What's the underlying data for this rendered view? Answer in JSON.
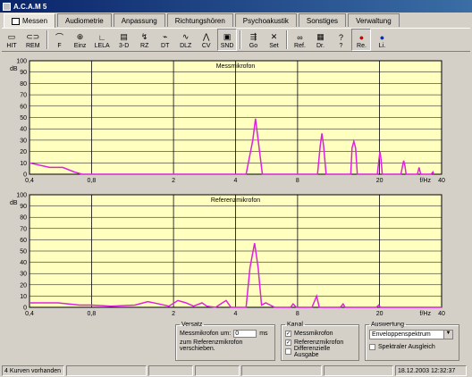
{
  "window": {
    "title": "A.C.A.M 5"
  },
  "tabs": [
    {
      "label": "Messen",
      "active": true
    },
    {
      "label": "Audiometrie"
    },
    {
      "label": "Anpassung"
    },
    {
      "label": "Richtungshören"
    },
    {
      "label": "Psychoakustik"
    },
    {
      "label": "Sonstiges"
    },
    {
      "label": "Verwaltung"
    }
  ],
  "toolbar": [
    {
      "label": "HIT",
      "icon": "hit-icon"
    },
    {
      "label": "REM",
      "icon": "rem-icon"
    },
    {
      "label": "F",
      "icon": "frequency-icon",
      "dropdown": true
    },
    {
      "label": "Einz",
      "icon": "single-icon",
      "dropdown": true
    },
    {
      "label": "LELA",
      "icon": "lela-icon"
    },
    {
      "label": "3-D",
      "icon": "3d-icon",
      "dropdown": true
    },
    {
      "label": "RZ",
      "icon": "rz-icon",
      "dropdown": true
    },
    {
      "label": "DT",
      "icon": "dt-icon",
      "dropdown": true
    },
    {
      "label": "DLZ",
      "icon": "dlz-icon"
    },
    {
      "label": "CV",
      "icon": "cv-icon"
    },
    {
      "label": "SND",
      "icon": "snd-icon",
      "dropdown": true
    },
    {
      "label": "Go",
      "icon": "go-icon",
      "dropdown": true
    },
    {
      "label": "Set",
      "icon": "settings-icon",
      "dropdown": true
    },
    {
      "label": "Ref.",
      "icon": "glasses-icon"
    },
    {
      "label": "Dr.",
      "icon": "printer-icon"
    },
    {
      "label": "?",
      "icon": "help-icon"
    },
    {
      "label": "Re.",
      "icon": "right-ear-icon"
    },
    {
      "label": "Li.",
      "icon": "left-ear-icon"
    }
  ],
  "chart_data": [
    {
      "type": "line",
      "title": "Messmikrofon",
      "ylabel": "dB",
      "xlabel": "f/Hz",
      "xscale": "log",
      "xlim": [
        0.4,
        40
      ],
      "ylim": [
        0,
        100
      ],
      "yticks": [
        0,
        10,
        20,
        30,
        40,
        50,
        60,
        70,
        80,
        90,
        100
      ],
      "xticks": [
        "0,4",
        "0,8",
        "2",
        "4",
        "8",
        "20",
        "40"
      ],
      "series_color": "#e020e0",
      "points": [
        [
          0.4,
          10
        ],
        [
          0.5,
          6
        ],
        [
          0.58,
          6
        ],
        [
          0.66,
          2
        ],
        [
          0.72,
          0
        ],
        [
          4.5,
          0
        ],
        [
          4.85,
          30
        ],
        [
          5.0,
          49
        ],
        [
          5.15,
          30
        ],
        [
          5.4,
          0
        ],
        [
          10.0,
          0
        ],
        [
          10.3,
          25
        ],
        [
          10.5,
          36
        ],
        [
          10.7,
          25
        ],
        [
          11.0,
          0
        ],
        [
          14.5,
          0
        ],
        [
          14.7,
          23
        ],
        [
          15.0,
          29
        ],
        [
          15.3,
          23
        ],
        [
          15.6,
          0
        ],
        [
          19.5,
          0
        ],
        [
          19.9,
          14
        ],
        [
          20.1,
          20
        ],
        [
          20.3,
          14
        ],
        [
          20.6,
          0
        ],
        [
          25.4,
          0
        ],
        [
          25.9,
          8
        ],
        [
          26.2,
          12
        ],
        [
          26.5,
          8
        ],
        [
          26.9,
          0
        ],
        [
          30.5,
          0
        ],
        [
          30.9,
          4
        ],
        [
          31.1,
          6
        ],
        [
          31.3,
          4
        ],
        [
          31.7,
          0
        ],
        [
          35.5,
          0
        ],
        [
          36.0,
          1
        ],
        [
          36.3,
          2
        ],
        [
          36.7,
          0
        ]
      ]
    },
    {
      "type": "line",
      "title": "Referenzmikrofon",
      "ylabel": "dB",
      "xlabel": "f/Hz",
      "xscale": "log",
      "xlim": [
        0.4,
        40
      ],
      "ylim": [
        0,
        100
      ],
      "yticks": [
        0,
        10,
        20,
        30,
        40,
        50,
        60,
        70,
        80,
        90,
        100
      ],
      "xticks": [
        "0,4",
        "0,8",
        "2",
        "4",
        "8",
        "20",
        "40"
      ],
      "series_color": "#e020e0",
      "points": [
        [
          0.4,
          4
        ],
        [
          0.55,
          4
        ],
        [
          0.7,
          2
        ],
        [
          0.8,
          2
        ],
        [
          1.0,
          1
        ],
        [
          1.3,
          2
        ],
        [
          1.5,
          5
        ],
        [
          1.7,
          3
        ],
        [
          1.9,
          1
        ],
        [
          2.1,
          6
        ],
        [
          2.3,
          4
        ],
        [
          2.5,
          1
        ],
        [
          2.75,
          4
        ],
        [
          2.9,
          1
        ],
        [
          3.2,
          0
        ],
        [
          3.45,
          4
        ],
        [
          3.6,
          6
        ],
        [
          3.8,
          0
        ],
        [
          4.5,
          0
        ],
        [
          4.7,
          35
        ],
        [
          4.95,
          57
        ],
        [
          5.15,
          35
        ],
        [
          5.35,
          2
        ],
        [
          5.6,
          4
        ],
        [
          6.2,
          0
        ],
        [
          7.4,
          0
        ],
        [
          7.6,
          3
        ],
        [
          7.9,
          0
        ],
        [
          9.4,
          0
        ],
        [
          9.9,
          10
        ],
        [
          10.2,
          0
        ],
        [
          12.9,
          0
        ],
        [
          13.3,
          3
        ],
        [
          13.6,
          0
        ],
        [
          19.3,
          0
        ],
        [
          19.8,
          2
        ],
        [
          20.2,
          0
        ],
        [
          40,
          0
        ]
      ]
    }
  ],
  "versatz": {
    "legend": "Versatz",
    "label_before": "Messmikrofon um:",
    "value": "0",
    "unit": "ms",
    "label_after": "zum Referenzmikrofon verschieben."
  },
  "kanal": {
    "legend": "Kanal",
    "options": [
      {
        "label": "Messmikrofon",
        "checked": true
      },
      {
        "label": "Referenzmikrofon",
        "checked": true
      },
      {
        "label": "Differenzielle Ausgabe",
        "checked": false
      }
    ]
  },
  "auswertung": {
    "legend": "Auswertung",
    "selected": "Enveloppenspektrum",
    "checkbox_label": "Spektraler Ausgleich",
    "checkbox_checked": false
  },
  "status": {
    "left": "4 Kurven vorhanden",
    "datetime": "18.12.2003 12:32:37"
  },
  "colors": {
    "plot_bg": "#ffffc0",
    "series": "#e020e0",
    "titlebar": "#0a246a"
  }
}
